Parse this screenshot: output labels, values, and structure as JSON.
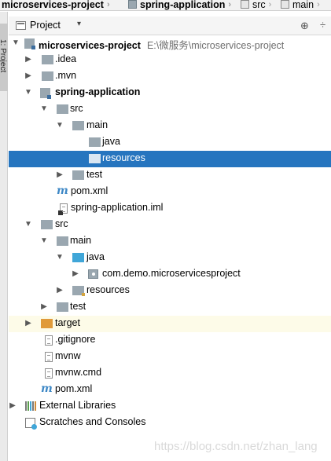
{
  "breadcrumbs": [
    {
      "label": "microservices-project",
      "bold": true
    },
    {
      "label": "spring-application",
      "bold": true
    },
    {
      "label": "src",
      "bold": false
    },
    {
      "label": "main",
      "bold": false
    }
  ],
  "side_tab": {
    "label": "1: Project"
  },
  "panel": {
    "title": "Project",
    "dropdown_glyph": "▾",
    "locate_glyph": "⊕",
    "settings_glyph": "÷"
  },
  "tree": [
    {
      "label": "microservices-project",
      "path": "E:\\微服务\\microservices-project",
      "bold": true
    },
    {
      "label": ".idea"
    },
    {
      "label": ".mvn"
    },
    {
      "label": "spring-application",
      "bold": true
    },
    {
      "label": "src"
    },
    {
      "label": "main"
    },
    {
      "label": "java"
    },
    {
      "label": "resources",
      "selected": true
    },
    {
      "label": "test"
    },
    {
      "label": "pom.xml"
    },
    {
      "label": "spring-application.iml"
    },
    {
      "label": "src"
    },
    {
      "label": "main"
    },
    {
      "label": "java"
    },
    {
      "label": "com.demo.microservicesproject"
    },
    {
      "label": "resources"
    },
    {
      "label": "test"
    },
    {
      "label": "target"
    },
    {
      "label": ".gitignore"
    },
    {
      "label": "mvnw"
    },
    {
      "label": "mvnw.cmd"
    },
    {
      "label": "pom.xml"
    },
    {
      "label": "External Libraries"
    },
    {
      "label": "Scratches and Consoles"
    }
  ],
  "watermark": "https://blog.csdn.net/zhan_lang",
  "colors": {
    "selection": "#2675bf",
    "excluded_row": "#fdfbe8",
    "source_folder": "#40a6d8",
    "excluded_folder": "#e09a3a",
    "folder": "#9aa7b0"
  }
}
